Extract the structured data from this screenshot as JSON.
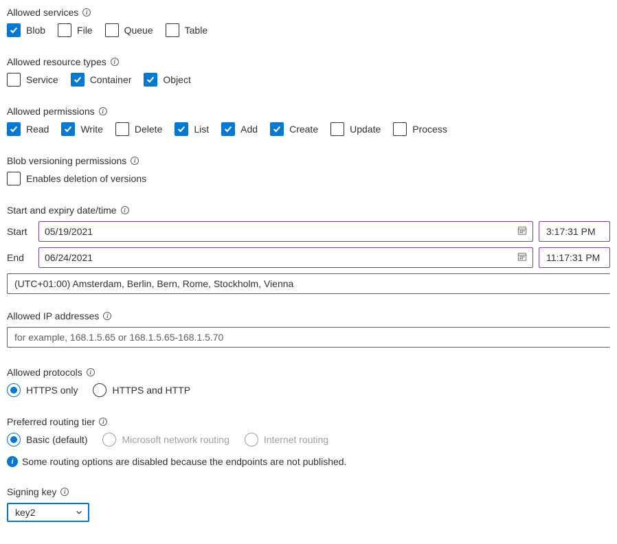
{
  "allowedServices": {
    "label": "Allowed services",
    "items": [
      {
        "label": "Blob",
        "checked": true
      },
      {
        "label": "File",
        "checked": false
      },
      {
        "label": "Queue",
        "checked": false
      },
      {
        "label": "Table",
        "checked": false
      }
    ]
  },
  "allowedResourceTypes": {
    "label": "Allowed resource types",
    "items": [
      {
        "label": "Service",
        "checked": false
      },
      {
        "label": "Container",
        "checked": true
      },
      {
        "label": "Object",
        "checked": true
      }
    ]
  },
  "allowedPermissions": {
    "label": "Allowed permissions",
    "items": [
      {
        "label": "Read",
        "checked": true
      },
      {
        "label": "Write",
        "checked": true
      },
      {
        "label": "Delete",
        "checked": false
      },
      {
        "label": "List",
        "checked": true
      },
      {
        "label": "Add",
        "checked": true
      },
      {
        "label": "Create",
        "checked": true
      },
      {
        "label": "Update",
        "checked": false
      },
      {
        "label": "Process",
        "checked": false
      }
    ]
  },
  "blobVersioning": {
    "label": "Blob versioning permissions",
    "items": [
      {
        "label": "Enables deletion of versions",
        "checked": false
      }
    ]
  },
  "dateTime": {
    "label": "Start and expiry date/time",
    "startLabel": "Start",
    "startDate": "05/19/2021",
    "startTime": "3:17:31 PM",
    "endLabel": "End",
    "endDate": "06/24/2021",
    "endTime": "11:17:31 PM",
    "timezone": "(UTC+01:00) Amsterdam, Berlin, Bern, Rome, Stockholm, Vienna"
  },
  "allowedIP": {
    "label": "Allowed IP addresses",
    "placeholder": "for example, 168.1.5.65 or 168.1.5.65-168.1.5.70"
  },
  "allowedProtocols": {
    "label": "Allowed protocols",
    "items": [
      {
        "label": "HTTPS only",
        "selected": true,
        "disabled": false
      },
      {
        "label": "HTTPS and HTTP",
        "selected": false,
        "disabled": false
      }
    ]
  },
  "routingTier": {
    "label": "Preferred routing tier",
    "items": [
      {
        "label": "Basic (default)",
        "selected": true,
        "disabled": false
      },
      {
        "label": "Microsoft network routing",
        "selected": false,
        "disabled": true
      },
      {
        "label": "Internet routing",
        "selected": false,
        "disabled": true
      }
    ],
    "notice": "Some routing options are disabled because the endpoints are not published."
  },
  "signingKey": {
    "label": "Signing key",
    "value": "key2"
  }
}
